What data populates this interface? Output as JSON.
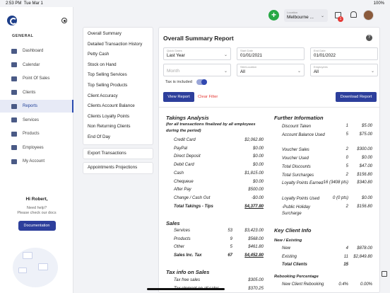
{
  "status_bar": {
    "time": "2:53 PM",
    "date": "Tue Mar 1",
    "battery": "100%"
  },
  "sidebar": {
    "section_label": "GENERAL",
    "items": [
      {
        "label": "Dashboard",
        "icon": "dashboard-icon"
      },
      {
        "label": "Calendar",
        "icon": "calendar-icon"
      },
      {
        "label": "Point Of Sales",
        "icon": "pos-icon"
      },
      {
        "label": "Clients",
        "icon": "clients-icon"
      },
      {
        "label": "Reports",
        "icon": "reports-icon",
        "active": true
      },
      {
        "label": "Services",
        "icon": "services-icon"
      },
      {
        "label": "Products",
        "icon": "products-icon"
      },
      {
        "label": "Employees",
        "icon": "employees-icon"
      },
      {
        "label": "My Account",
        "icon": "gear-icon"
      }
    ],
    "help": {
      "greeting": "Hi Robert,",
      "question": "Need help?",
      "hint": "Please check our docs",
      "button": "Documentation"
    }
  },
  "topbar": {
    "location_label": "Location",
    "location_value": "Melbourne ...",
    "notification_count": "1"
  },
  "report_menu": {
    "items": [
      "Overall Summary",
      "Detailed Transaction History",
      "Petty Cash",
      "Stock on Hand",
      "Top Selling Services",
      "Top Selling Products",
      "Client Accuracy",
      "Clients Account Balance",
      "Clients Loyalty Points",
      "Non Returning Clients",
      "End Of Day"
    ],
    "extra1": "Export Transactions",
    "extra2": "Appointments Projections"
  },
  "main": {
    "title": "Overall Summary Report",
    "filters": {
      "quick_dates_label": "Quick Dates",
      "quick_dates_value": "Last Year",
      "start_label": "Start Date",
      "start_value": "01/01/2021",
      "end_label": "End Date",
      "end_value": "01/01/2022",
      "month_placeholder": "Month",
      "site_label": "Site/Location",
      "site_value": "All",
      "emp_label": "Employees",
      "emp_value": "All",
      "tax_label": "Tax is included"
    },
    "buttons": {
      "view": "View Report",
      "clear": "Clear Filter",
      "download": "Download Report"
    },
    "takings": {
      "title": "Takings Analysis",
      "subtitle": "(for all transactions finalized by all employees during the period)",
      "rows": [
        {
          "label": "Credit Card",
          "amount": "$2,062.80"
        },
        {
          "label": "PayPal",
          "amount": "$0.00"
        },
        {
          "label": "Direct Deposit",
          "amount": "$0.00"
        },
        {
          "label": "Debit Card",
          "amount": "$0.00"
        },
        {
          "label": "Cash",
          "amount": "$1,815.00"
        },
        {
          "label": "Chequeue",
          "amount": "$0.00"
        },
        {
          "label": "After Pay",
          "amount": "$500.00"
        },
        {
          "label": "Change / Cash Out",
          "amount": "-$0.00"
        },
        {
          "label": "Total Takings - Tips",
          "amount": "$4,377.80"
        }
      ]
    },
    "sales": {
      "title": "Sales",
      "rows": [
        {
          "label": "Services",
          "count": "53",
          "amount": "$3,423.00"
        },
        {
          "label": "Products",
          "count": "9",
          "amount": "$568.00"
        },
        {
          "label": "Other",
          "count": "5",
          "amount": "$461.80"
        },
        {
          "label": "Sales Inc. Tax",
          "count": "67",
          "amount": "$4,452.80"
        }
      ]
    },
    "tax": {
      "title": "Tax info on Sales",
      "rows": [
        {
          "label": "Tax free sales",
          "amount": "$305.00"
        },
        {
          "label": "Tax element on all sales",
          "amount": "$370.25"
        }
      ]
    },
    "further": {
      "title": "Further Information",
      "rows": [
        {
          "label": "Discount Taken",
          "count": "1",
          "amount": "$5.00"
        },
        {
          "label": "Account Balance Used",
          "count": "5",
          "amount": "$75.00"
        },
        {
          "label": "Voucher Sales",
          "count": "2",
          "amount": "$300.00"
        },
        {
          "label": "Voucher Used",
          "count": "0",
          "amount": "$0.00"
        },
        {
          "label": "Total Discounts",
          "count": "5",
          "amount": "$47.00"
        },
        {
          "label": "Total Surcharges",
          "count": "2",
          "amount": "$156.80"
        },
        {
          "label": "Loyalty Points Earned",
          "count": "16 (3408 pts)",
          "amount": "$340.80"
        },
        {
          "label": "Loyalty Points Used",
          "count": "0 (0 pts)",
          "amount": "$0.00"
        },
        {
          "label": "-Public Holiday Surcharge",
          "count": "2",
          "amount": "$156.80"
        }
      ]
    },
    "client": {
      "title": "Key Client Info",
      "new_existing": "New / Existing",
      "rows": [
        {
          "label": "New",
          "count": "4",
          "amount": "$878.00"
        },
        {
          "label": "Existing",
          "count": "11",
          "amount": "$2,849.80"
        },
        {
          "label": "Total Clients",
          "count": "15",
          "amount": ""
        }
      ],
      "rebooking": "Rebooking Percentage",
      "rebook_rows": [
        {
          "label": "New Client Rebooking",
          "count": "0.4%",
          "amount": "0.00%"
        }
      ]
    }
  }
}
